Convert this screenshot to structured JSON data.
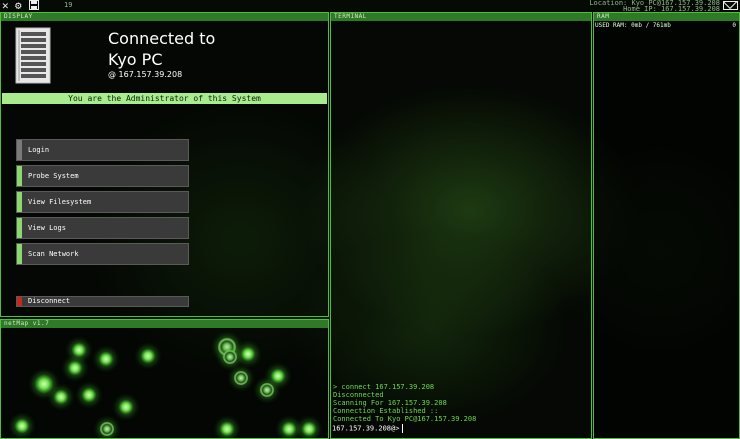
{
  "topbar": {
    "count": "19",
    "location": "Location: Kyo PC@167.157.39.208",
    "home_ip": "Home IP: 167.157.39.208"
  },
  "display": {
    "header": "DISPLAY",
    "title_line1": "Connected to",
    "title_line2": "Kyo PC",
    "ip": "@  167.157.39.208",
    "admin_text": "You are the Administrator of this System",
    "menu": [
      {
        "label": "Login"
      },
      {
        "label": "Probe System"
      },
      {
        "label": "View Filesystem"
      },
      {
        "label": "View Logs"
      },
      {
        "label": "Scan Network"
      }
    ],
    "disconnect": "Disconnect"
  },
  "terminal": {
    "header": "TERMINAL",
    "lines": [
      "> connect 167.157.39.208",
      "Disconnected",
      "Scanning For 167.157.39.208",
      "Connection Established ::",
      "Connected To Kyo PC@167.157.39.208"
    ],
    "prompt": "167.157.39.208@>"
  },
  "ram": {
    "header": "RAM",
    "used_label": "USED RAM: 0mb / 761mb",
    "count": "0"
  },
  "netmap": {
    "header": "netMap v1.7"
  },
  "colors": {
    "accent": "#4fbf3a",
    "admin_bar": "#a8ec8e",
    "button_stripe": "#8ad86f",
    "disconnect_stripe": "#c22a1e",
    "terminal_text": "#6fd84e"
  },
  "icons": {
    "close": "close-icon",
    "settings": "gear-icon",
    "save": "save-icon",
    "mail": "mail-icon",
    "server": "server-rack-icon"
  }
}
